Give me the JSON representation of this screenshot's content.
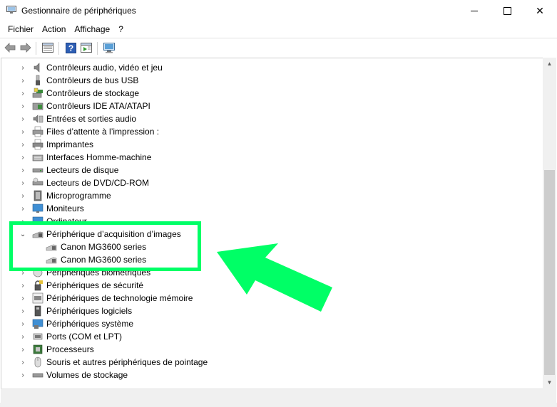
{
  "window": {
    "title": "Gestionnaire de périphériques",
    "controls": {
      "minimize": "minimize",
      "maximize": "maximize",
      "close": "✕"
    }
  },
  "menu": [
    "Fichier",
    "Action",
    "Affichage",
    "?"
  ],
  "tree": {
    "items": [
      {
        "label": "Contrôleurs audio, vidéo et jeu",
        "icon": "speaker-icon"
      },
      {
        "label": "Contrôleurs de bus USB",
        "icon": "usb-icon"
      },
      {
        "label": "Contrôleurs de stockage",
        "icon": "storage-controller-icon"
      },
      {
        "label": "Contrôleurs IDE ATA/ATAPI",
        "icon": "ide-icon"
      },
      {
        "label": "Entrées et sorties audio",
        "icon": "audio-io-icon"
      },
      {
        "label": "Files d’attente à l’impression :",
        "icon": "print-queue-icon"
      },
      {
        "label": "Imprimantes",
        "icon": "printer-icon"
      },
      {
        "label": "Interfaces Homme-machine",
        "icon": "hid-icon"
      },
      {
        "label": "Lecteurs de disque",
        "icon": "disk-drive-icon"
      },
      {
        "label": "Lecteurs de DVD/CD-ROM",
        "icon": "dvd-icon"
      },
      {
        "label": "Microprogramme",
        "icon": "firmware-icon"
      },
      {
        "label": "Moniteurs",
        "icon": "monitor-icon"
      },
      {
        "label": "Ordinateur",
        "icon": "computer-icon"
      },
      {
        "label": "Périphérique d’acquisition d’images",
        "icon": "scanner-icon",
        "expanded": true
      },
      {
        "label": "Canon MG3600 series",
        "icon": "scanner-device-icon",
        "child": true
      },
      {
        "label": "Canon MG3600 series",
        "icon": "scanner-device-icon",
        "child": true
      },
      {
        "label": "Périphériques biométriques",
        "icon": "biometric-icon"
      },
      {
        "label": "Périphériques de sécurité",
        "icon": "security-icon"
      },
      {
        "label": "Périphériques de technologie mémoire",
        "icon": "memory-tech-icon"
      },
      {
        "label": "Périphériques logiciels",
        "icon": "software-device-icon"
      },
      {
        "label": "Périphériques système",
        "icon": "system-device-icon"
      },
      {
        "label": "Ports (COM et LPT)",
        "icon": "port-icon"
      },
      {
        "label": "Processeurs",
        "icon": "processor-icon"
      },
      {
        "label": "Souris et autres périphériques de pointage",
        "icon": "mouse-icon"
      },
      {
        "label": "Volumes de stockage",
        "icon": "storage-volume-icon"
      }
    ]
  },
  "annotation": {
    "highlight_color": "#00ff66",
    "arrow_color": "#00ff66"
  }
}
